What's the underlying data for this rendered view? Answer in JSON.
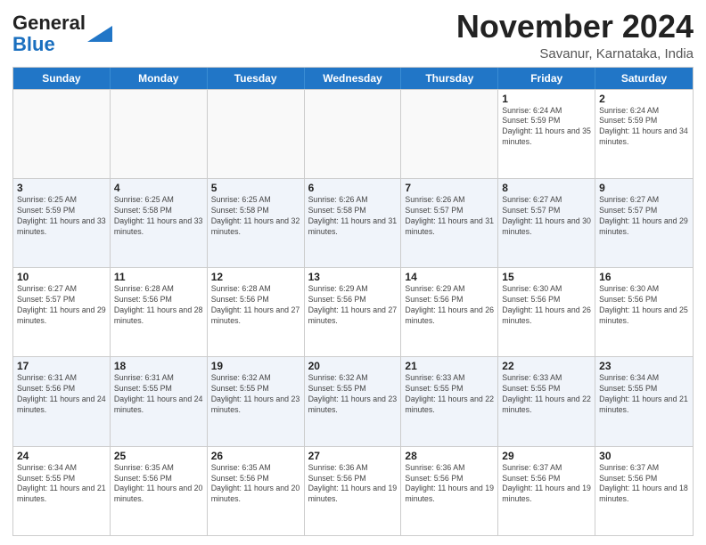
{
  "header": {
    "logo_general": "General",
    "logo_blue": "Blue",
    "month_title": "November 2024",
    "location": "Savanur, Karnataka, India"
  },
  "weekdays": [
    "Sunday",
    "Monday",
    "Tuesday",
    "Wednesday",
    "Thursday",
    "Friday",
    "Saturday"
  ],
  "rows": [
    [
      {
        "day": "",
        "empty": true
      },
      {
        "day": "",
        "empty": true
      },
      {
        "day": "",
        "empty": true
      },
      {
        "day": "",
        "empty": true
      },
      {
        "day": "",
        "empty": true
      },
      {
        "day": "1",
        "sunrise": "6:24 AM",
        "sunset": "5:59 PM",
        "daylight": "11 hours and 35 minutes."
      },
      {
        "day": "2",
        "sunrise": "6:24 AM",
        "sunset": "5:59 PM",
        "daylight": "11 hours and 34 minutes."
      }
    ],
    [
      {
        "day": "3",
        "sunrise": "6:25 AM",
        "sunset": "5:59 PM",
        "daylight": "11 hours and 33 minutes."
      },
      {
        "day": "4",
        "sunrise": "6:25 AM",
        "sunset": "5:58 PM",
        "daylight": "11 hours and 33 minutes."
      },
      {
        "day": "5",
        "sunrise": "6:25 AM",
        "sunset": "5:58 PM",
        "daylight": "11 hours and 32 minutes."
      },
      {
        "day": "6",
        "sunrise": "6:26 AM",
        "sunset": "5:58 PM",
        "daylight": "11 hours and 31 minutes."
      },
      {
        "day": "7",
        "sunrise": "6:26 AM",
        "sunset": "5:57 PM",
        "daylight": "11 hours and 31 minutes."
      },
      {
        "day": "8",
        "sunrise": "6:27 AM",
        "sunset": "5:57 PM",
        "daylight": "11 hours and 30 minutes."
      },
      {
        "day": "9",
        "sunrise": "6:27 AM",
        "sunset": "5:57 PM",
        "daylight": "11 hours and 29 minutes."
      }
    ],
    [
      {
        "day": "10",
        "sunrise": "6:27 AM",
        "sunset": "5:57 PM",
        "daylight": "11 hours and 29 minutes."
      },
      {
        "day": "11",
        "sunrise": "6:28 AM",
        "sunset": "5:56 PM",
        "daylight": "11 hours and 28 minutes."
      },
      {
        "day": "12",
        "sunrise": "6:28 AM",
        "sunset": "5:56 PM",
        "daylight": "11 hours and 27 minutes."
      },
      {
        "day": "13",
        "sunrise": "6:29 AM",
        "sunset": "5:56 PM",
        "daylight": "11 hours and 27 minutes."
      },
      {
        "day": "14",
        "sunrise": "6:29 AM",
        "sunset": "5:56 PM",
        "daylight": "11 hours and 26 minutes."
      },
      {
        "day": "15",
        "sunrise": "6:30 AM",
        "sunset": "5:56 PM",
        "daylight": "11 hours and 26 minutes."
      },
      {
        "day": "16",
        "sunrise": "6:30 AM",
        "sunset": "5:56 PM",
        "daylight": "11 hours and 25 minutes."
      }
    ],
    [
      {
        "day": "17",
        "sunrise": "6:31 AM",
        "sunset": "5:56 PM",
        "daylight": "11 hours and 24 minutes."
      },
      {
        "day": "18",
        "sunrise": "6:31 AM",
        "sunset": "5:55 PM",
        "daylight": "11 hours and 24 minutes."
      },
      {
        "day": "19",
        "sunrise": "6:32 AM",
        "sunset": "5:55 PM",
        "daylight": "11 hours and 23 minutes."
      },
      {
        "day": "20",
        "sunrise": "6:32 AM",
        "sunset": "5:55 PM",
        "daylight": "11 hours and 23 minutes."
      },
      {
        "day": "21",
        "sunrise": "6:33 AM",
        "sunset": "5:55 PM",
        "daylight": "11 hours and 22 minutes."
      },
      {
        "day": "22",
        "sunrise": "6:33 AM",
        "sunset": "5:55 PM",
        "daylight": "11 hours and 22 minutes."
      },
      {
        "day": "23",
        "sunrise": "6:34 AM",
        "sunset": "5:55 PM",
        "daylight": "11 hours and 21 minutes."
      }
    ],
    [
      {
        "day": "24",
        "sunrise": "6:34 AM",
        "sunset": "5:55 PM",
        "daylight": "11 hours and 21 minutes."
      },
      {
        "day": "25",
        "sunrise": "6:35 AM",
        "sunset": "5:56 PM",
        "daylight": "11 hours and 20 minutes."
      },
      {
        "day": "26",
        "sunrise": "6:35 AM",
        "sunset": "5:56 PM",
        "daylight": "11 hours and 20 minutes."
      },
      {
        "day": "27",
        "sunrise": "6:36 AM",
        "sunset": "5:56 PM",
        "daylight": "11 hours and 19 minutes."
      },
      {
        "day": "28",
        "sunrise": "6:36 AM",
        "sunset": "5:56 PM",
        "daylight": "11 hours and 19 minutes."
      },
      {
        "day": "29",
        "sunrise": "6:37 AM",
        "sunset": "5:56 PM",
        "daylight": "11 hours and 19 minutes."
      },
      {
        "day": "30",
        "sunrise": "6:37 AM",
        "sunset": "5:56 PM",
        "daylight": "11 hours and 18 minutes."
      }
    ]
  ]
}
